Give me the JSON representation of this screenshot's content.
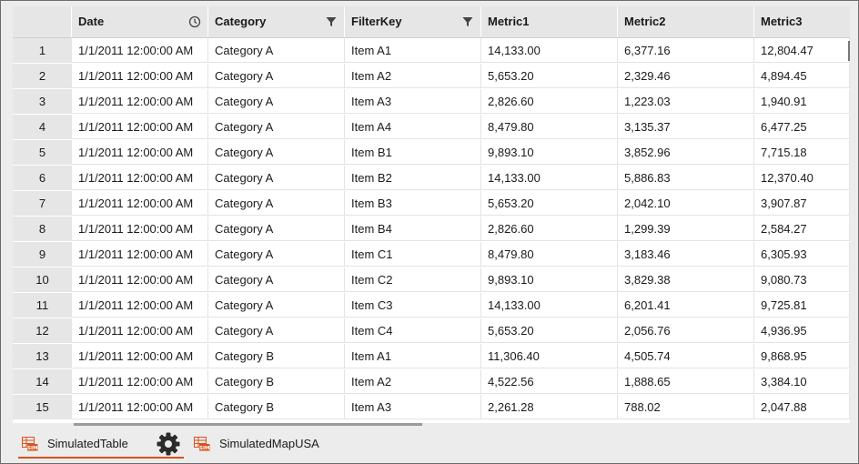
{
  "grid": {
    "columns": [
      "Date",
      "Category",
      "FilterKey",
      "Metric1",
      "Metric2",
      "Metric3"
    ],
    "header_icons": [
      "clock-icon",
      "filter-icon",
      "filter-icon"
    ],
    "rows": [
      {
        "num": "1",
        "date": "1/1/2011 12:00:00 AM",
        "category": "Category A",
        "filterkey": "Item A1",
        "m1": "14,133.00",
        "m2": "6,377.16",
        "m3": "12,804.47"
      },
      {
        "num": "2",
        "date": "1/1/2011 12:00:00 AM",
        "category": "Category A",
        "filterkey": "Item A2",
        "m1": "5,653.20",
        "m2": "2,329.46",
        "m3": "4,894.45"
      },
      {
        "num": "3",
        "date": "1/1/2011 12:00:00 AM",
        "category": "Category A",
        "filterkey": "Item A3",
        "m1": "2,826.60",
        "m2": "1,223.03",
        "m3": "1,940.91"
      },
      {
        "num": "4",
        "date": "1/1/2011 12:00:00 AM",
        "category": "Category A",
        "filterkey": "Item A4",
        "m1": "8,479.80",
        "m2": "3,135.37",
        "m3": "6,477.25"
      },
      {
        "num": "5",
        "date": "1/1/2011 12:00:00 AM",
        "category": "Category A",
        "filterkey": "Item B1",
        "m1": "9,893.10",
        "m2": "3,852.96",
        "m3": "7,715.18"
      },
      {
        "num": "6",
        "date": "1/1/2011 12:00:00 AM",
        "category": "Category A",
        "filterkey": "Item B2",
        "m1": "14,133.00",
        "m2": "5,886.83",
        "m3": "12,370.40"
      },
      {
        "num": "7",
        "date": "1/1/2011 12:00:00 AM",
        "category": "Category A",
        "filterkey": "Item B3",
        "m1": "5,653.20",
        "m2": "2,042.10",
        "m3": "3,907.87"
      },
      {
        "num": "8",
        "date": "1/1/2011 12:00:00 AM",
        "category": "Category A",
        "filterkey": "Item B4",
        "m1": "2,826.60",
        "m2": "1,299.39",
        "m3": "2,584.27"
      },
      {
        "num": "9",
        "date": "1/1/2011 12:00:00 AM",
        "category": "Category A",
        "filterkey": "Item C1",
        "m1": "8,479.80",
        "m2": "3,183.46",
        "m3": "6,305.93"
      },
      {
        "num": "10",
        "date": "1/1/2011 12:00:00 AM",
        "category": "Category A",
        "filterkey": "Item C2",
        "m1": "9,893.10",
        "m2": "3,829.38",
        "m3": "9,080.73"
      },
      {
        "num": "11",
        "date": "1/1/2011 12:00:00 AM",
        "category": "Category A",
        "filterkey": "Item C3",
        "m1": "14,133.00",
        "m2": "6,201.41",
        "m3": "9,725.81"
      },
      {
        "num": "12",
        "date": "1/1/2011 12:00:00 AM",
        "category": "Category A",
        "filterkey": "Item C4",
        "m1": "5,653.20",
        "m2": "2,056.76",
        "m3": "4,936.95"
      },
      {
        "num": "13",
        "date": "1/1/2011 12:00:00 AM",
        "category": "Category B",
        "filterkey": "Item A1",
        "m1": "11,306.40",
        "m2": "4,505.74",
        "m3": "9,868.95"
      },
      {
        "num": "14",
        "date": "1/1/2011 12:00:00 AM",
        "category": "Category B",
        "filterkey": "Item A2",
        "m1": "4,522.56",
        "m2": "1,888.65",
        "m3": "3,384.10"
      },
      {
        "num": "15",
        "date": "1/1/2011 12:00:00 AM",
        "category": "Category B",
        "filterkey": "Item A3",
        "m1": "2,261.28",
        "m2": "788.02",
        "m3": "2,047.88"
      }
    ]
  },
  "tabs": [
    {
      "label": "SimulatedTable",
      "icon": "table-sim-icon",
      "active": true
    },
    {
      "label": "SimulatedMapUSA",
      "icon": "table-sim-icon",
      "active": false
    }
  ],
  "tab_settings_icon": "gear-icon",
  "colors": {
    "accent": "#d9531e",
    "header_bg": "#e6e6e6"
  }
}
